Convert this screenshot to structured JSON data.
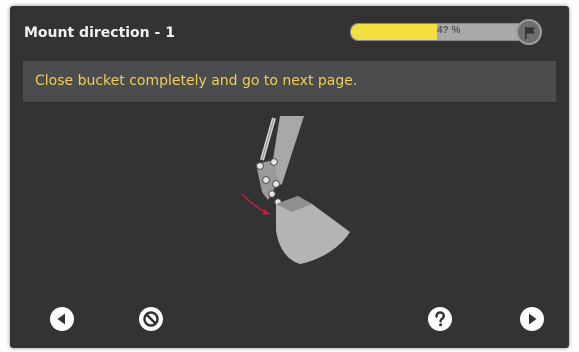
{
  "header": {
    "title": "Mount direction - 1",
    "progress_percent": 46,
    "progress_label": "4? %"
  },
  "banner": {
    "instruction": "Close bucket completely and go to next page."
  },
  "footer": {
    "buttons": [
      "back-icon",
      "cancel-icon",
      "help-icon",
      "next-icon"
    ]
  },
  "colors": {
    "background": "#333336",
    "banner": "#4c4c4f",
    "instruction_text": "#f1cf52",
    "progress_fill": "#f3df3f",
    "arrow": "#cc2233"
  }
}
